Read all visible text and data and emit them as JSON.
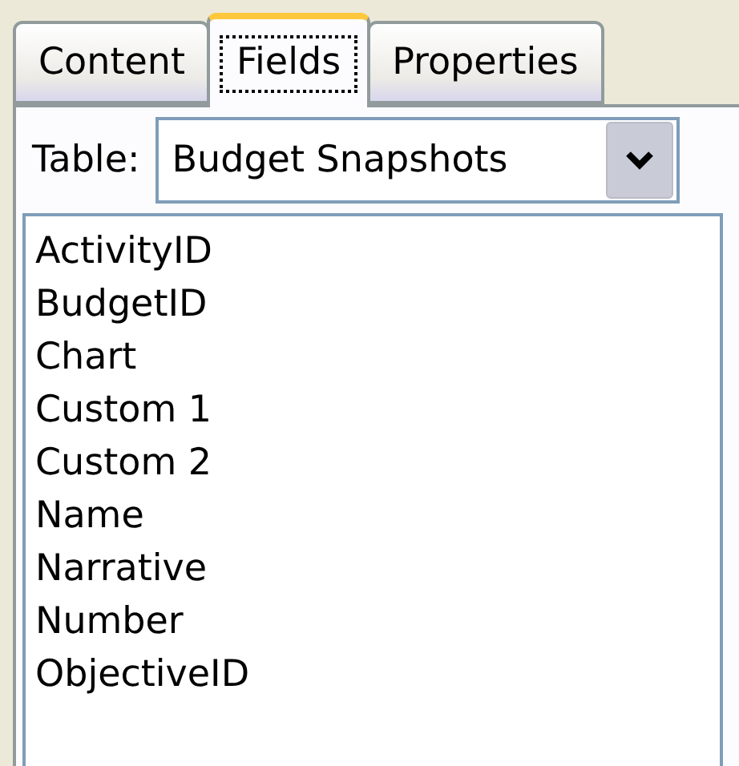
{
  "tabs": [
    {
      "label": "Content",
      "selected": false
    },
    {
      "label": "Fields",
      "selected": true
    },
    {
      "label": "Properties",
      "selected": false
    }
  ],
  "table_selector": {
    "label": "Table:",
    "value": "Budget Snapshots"
  },
  "fields": [
    "ActivityID",
    "BudgetID",
    "Chart",
    "Custom 1",
    "Custom 2",
    "Name",
    "Narrative",
    "Number",
    "ObjectiveID"
  ]
}
